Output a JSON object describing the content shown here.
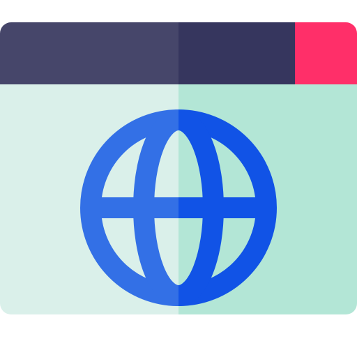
{
  "icon": {
    "name": "web-browser-globe-icon",
    "colors": {
      "titlebar_left": "#46466A",
      "titlebar_right": "#36365E",
      "close_block": "#FF2F69",
      "body_left": "#DAF0EA",
      "body_right": "#B3E6D6",
      "globe_left": "#3370E6",
      "globe_right": "#1153E6"
    }
  }
}
